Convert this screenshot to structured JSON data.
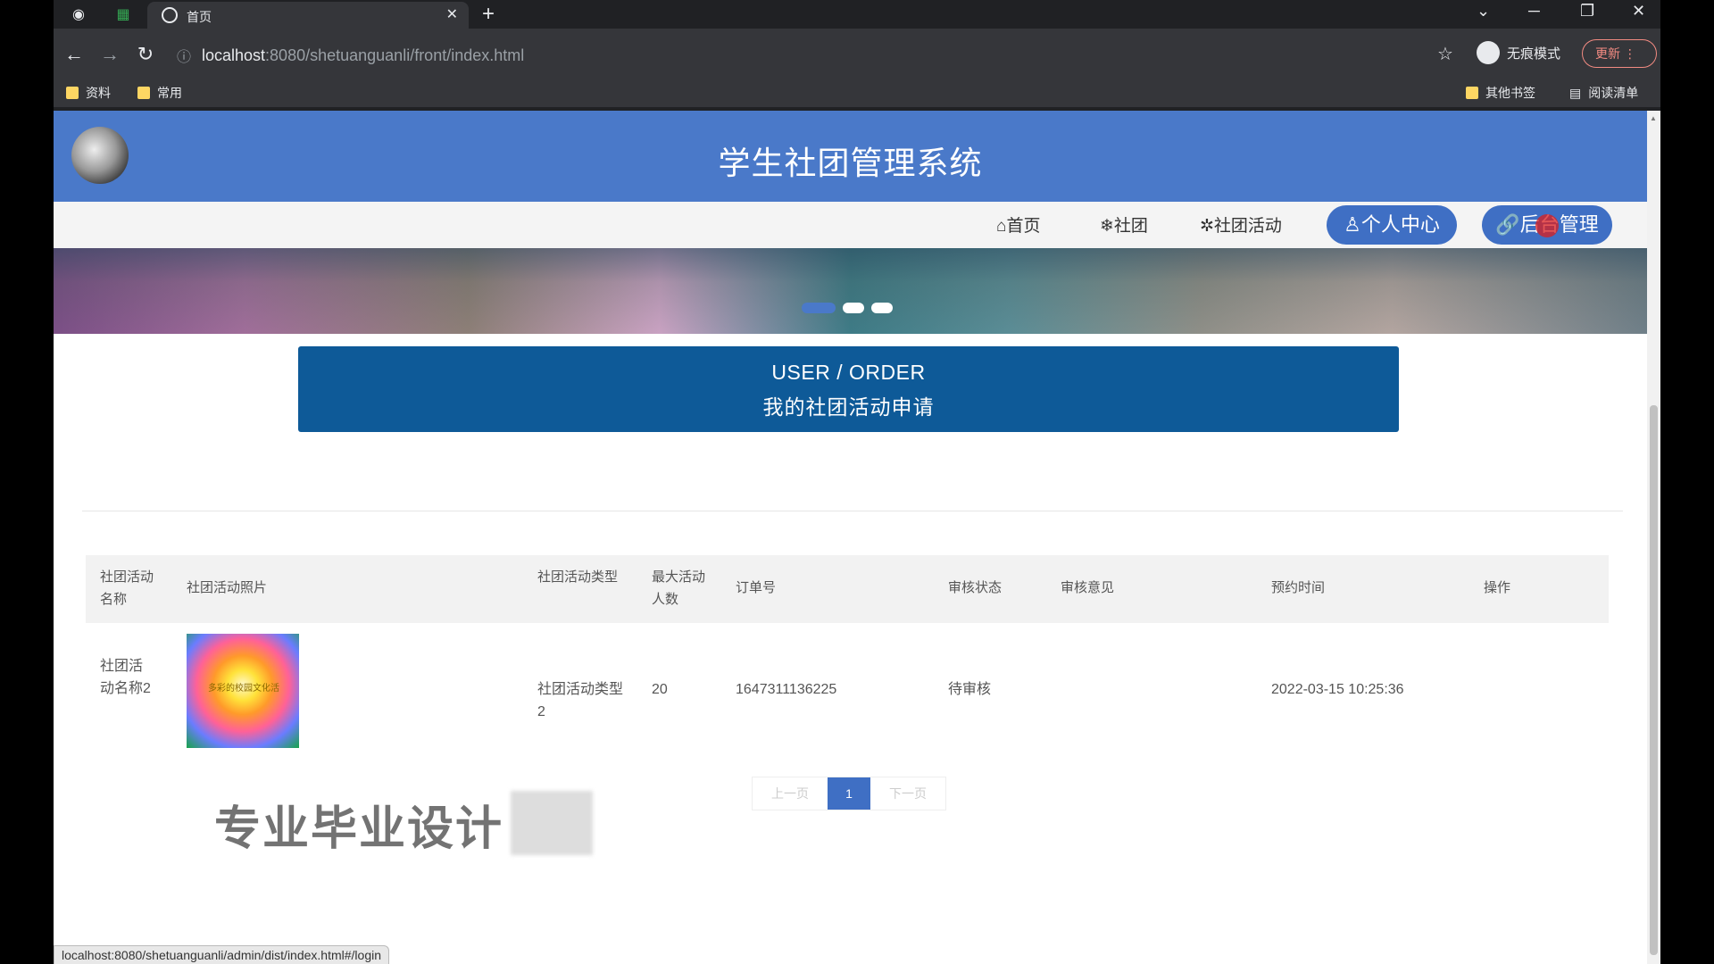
{
  "browser": {
    "tab_title": "首页",
    "new_tab": "+",
    "close_tab": "✕",
    "address_host": "localhost",
    "address_rest": ":8080/shetuanguanli/front/index.html",
    "profile_label": "无痕模式",
    "update_label": "更新",
    "bookmarks": [
      {
        "label": "资料"
      },
      {
        "label": "常用"
      }
    ],
    "bookmarks_right": [
      {
        "label": "其他书签"
      },
      {
        "label": "阅读清单"
      }
    ],
    "status_url": "localhost:8080/shetuanguanli/admin/dist/index.html#/login"
  },
  "site": {
    "title": "学生社团管理系统",
    "nav": {
      "home": "首页",
      "clubs": "社团",
      "activities": "社团活动",
      "profile": "个人中心",
      "admin": "后台管理"
    },
    "banner_dots": 3,
    "section_en": "USER / ORDER",
    "section_cn": "我的社团活动申请",
    "colors": {
      "header": "#4a79c9",
      "pill": "#3f6fc4",
      "section": "#0e5a98"
    }
  },
  "table": {
    "headers": [
      "社团活动名称",
      "社团活动照片",
      "社团活动类型",
      "最大活动人数",
      "订单号",
      "审核状态",
      "审核意见",
      "预约时间",
      "操作"
    ],
    "rows": [
      {
        "name": "社团活动名称2",
        "photo_caption": "多彩的校园文化活",
        "type": "社团活动类型2",
        "max": "20",
        "order_no": "1647311136225",
        "status": "待审核",
        "opinion": "",
        "time": "2022-03-15 10:25:36",
        "action": ""
      }
    ]
  },
  "pagination": {
    "prev": "上一页",
    "current": "1",
    "next": "下一页"
  },
  "watermark": "专业毕业设计"
}
